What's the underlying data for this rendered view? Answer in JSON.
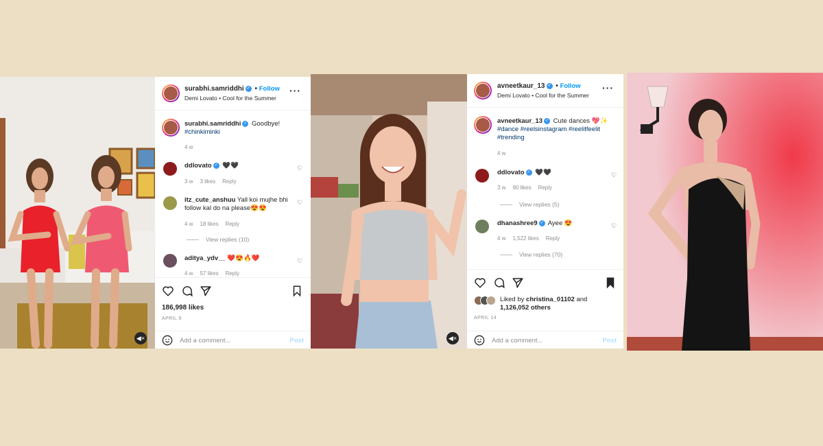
{
  "posts": [
    {
      "username": "surabhi.samriddhi",
      "follow_label": "Follow",
      "audio": "Demi Lovato • Cool for the Summer",
      "caption_user": "surabhi.samriddhi",
      "caption_text": "Goodbye!",
      "caption_tags": "#chinkiminki",
      "caption_time": "4 w",
      "comments": [
        {
          "user": "ddlovato",
          "text": "🖤🖤",
          "time": "3 w",
          "likes": "3 likes",
          "reply": "Reply"
        },
        {
          "user": "itz_cute_anshuu",
          "text": "Yall koi mujhe bhi follow kal do na please😍😍",
          "time": "4 w",
          "likes": "18 likes",
          "reply": "Reply",
          "view_replies": "View replies (10)"
        },
        {
          "user": "aditya_ydv__",
          "text": "❤️😍🔥❤️",
          "time": "4 w",
          "likes": "57 likes",
          "reply": "Reply"
        }
      ],
      "likes": "186,998 likes",
      "date": "APRIL 9",
      "add_comment_placeholder": "Add a comment...",
      "post_label": "Post"
    },
    {
      "username": "avneetkaur_13",
      "follow_label": "Follow",
      "audio": "Demi Lovato • Cool for the Summer",
      "caption_user": "avneetkaur_13",
      "caption_text": "Cute dances 💖✨",
      "caption_tags": "#dance #reelsinstagram #reelitfeelit #trending",
      "caption_time": "4 w",
      "comments": [
        {
          "user": "ddlovato",
          "text": "🖤🖤",
          "time": "3 w",
          "likes": "90 likes",
          "reply": "Reply",
          "view_replies": "View replies (5)"
        },
        {
          "user": "dhanashree9",
          "text": "Ayee 😍",
          "time": "4 w",
          "likes": "1,522 likes",
          "reply": "Reply",
          "view_replies": "View replies (70)"
        }
      ],
      "liked_by_prefix": "Liked by",
      "liked_by_user": "christina_01102",
      "liked_by_and": "and",
      "liked_by_others": "1,126,052 others",
      "date": "APRIL 14",
      "add_comment_placeholder": "Add a comment...",
      "post_label": "Post"
    }
  ],
  "icons": [
    "heart-icon",
    "comment-icon",
    "share-icon",
    "bookmark-icon",
    "more-icon",
    "verified-icon",
    "emoji-icon",
    "mute-icon"
  ],
  "colors": {
    "background": "#ecdfc4",
    "link": "#0095f6",
    "hashtag": "#00376b",
    "muted": "#8e8e8e"
  }
}
